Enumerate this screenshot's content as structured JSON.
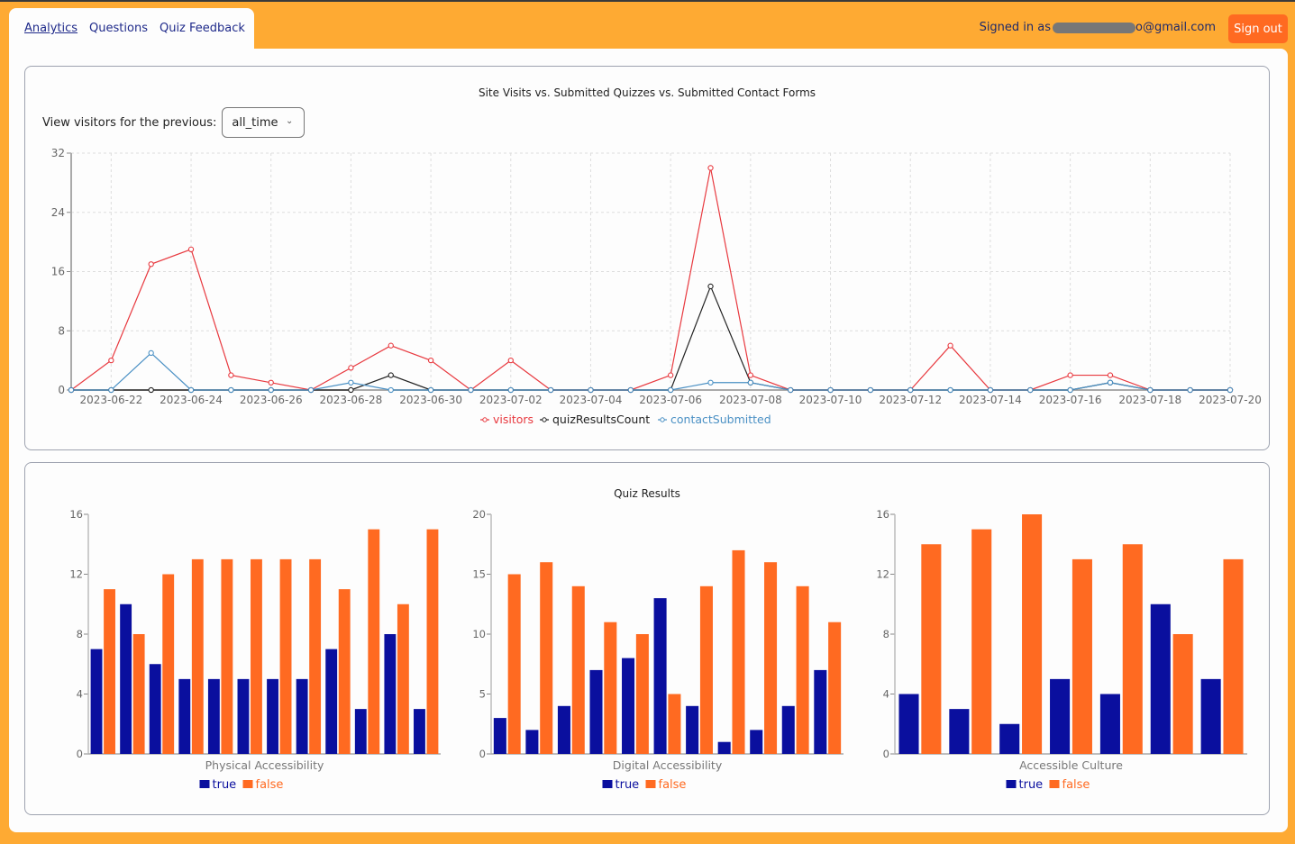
{
  "nav": {
    "items": [
      {
        "label": "Analytics",
        "active": true
      },
      {
        "label": "Questions",
        "active": false
      },
      {
        "label": "Quiz Feedback",
        "active": false
      }
    ]
  },
  "user": {
    "signed_in_prefix": "Signed in as",
    "email_suffix": "o@gmail.com",
    "sign_out_label": "Sign out"
  },
  "colors": {
    "accent": "#feaa33",
    "button": "#ff6a21",
    "true_bar": "#0a0f9e",
    "false_bar": "#ff6a21",
    "visitors": "#e8393f",
    "quiz": "#222222",
    "contact": "#4a90c4"
  },
  "filter": {
    "label": "View visitors for the previous:",
    "value": "all_time"
  },
  "chart_data": [
    {
      "type": "line",
      "title": "Site Visits vs. Submitted Quizzes vs. Submitted Contact Forms",
      "x": [
        "2023-06-21",
        "2023-06-22",
        "2023-06-23",
        "2023-06-24",
        "2023-06-25",
        "2023-06-26",
        "2023-06-27",
        "2023-06-28",
        "2023-06-29",
        "2023-06-30",
        "2023-07-01",
        "2023-07-02",
        "2023-07-03",
        "2023-07-04",
        "2023-07-05",
        "2023-07-06",
        "2023-07-07",
        "2023-07-08",
        "2023-07-09",
        "2023-07-10",
        "2023-07-11",
        "2023-07-12",
        "2023-07-13",
        "2023-07-14",
        "2023-07-15",
        "2023-07-16",
        "2023-07-17",
        "2023-07-18",
        "2023-07-19",
        "2023-07-20"
      ],
      "x_tick_labels": [
        "2023-06-22",
        "2023-06-24",
        "2023-06-26",
        "2023-06-28",
        "2023-06-30",
        "2023-07-02",
        "2023-07-04",
        "2023-07-06",
        "2023-07-08",
        "2023-07-10",
        "2023-07-12",
        "2023-07-14",
        "2023-07-16",
        "2023-07-18",
        "2023-07-20"
      ],
      "y_ticks": [
        0,
        8,
        16,
        24,
        32
      ],
      "ylim": [
        0,
        32
      ],
      "grid": true,
      "legend_position": "bottom",
      "series": [
        {
          "name": "visitors",
          "color": "#e8393f",
          "values": [
            0,
            4,
            17,
            19,
            2,
            1,
            0,
            3,
            6,
            4,
            0,
            4,
            0,
            0,
            0,
            2,
            30,
            2,
            0,
            0,
            0,
            0,
            6,
            0,
            0,
            2,
            2,
            0,
            0,
            0
          ]
        },
        {
          "name": "quizResultsCount",
          "color": "#222222",
          "values": [
            0,
            0,
            0,
            0,
            0,
            0,
            0,
            0,
            2,
            0,
            0,
            0,
            0,
            0,
            0,
            0,
            14,
            1,
            0,
            0,
            0,
            0,
            0,
            0,
            0,
            0,
            1,
            0,
            0,
            0
          ]
        },
        {
          "name": "contactSubmitted",
          "color": "#4a90c4",
          "values": [
            0,
            0,
            5,
            0,
            0,
            0,
            0,
            1,
            0,
            0,
            0,
            0,
            0,
            0,
            0,
            0,
            1,
            1,
            0,
            0,
            0,
            0,
            0,
            0,
            0,
            0,
            1,
            0,
            0,
            0
          ]
        }
      ]
    },
    {
      "type": "bar",
      "title": "Quiz Results",
      "xlabel": "Physical Accessibility",
      "ylim": [
        0,
        16
      ],
      "y_ticks": [
        0,
        4,
        8,
        12,
        16
      ],
      "legend": [
        "true",
        "false"
      ],
      "series": [
        {
          "name": "true",
          "values": [
            7,
            10,
            6,
            5,
            5,
            5,
            5,
            5,
            7,
            3,
            8,
            3
          ]
        },
        {
          "name": "false",
          "values": [
            11,
            8,
            12,
            13,
            13,
            13,
            13,
            13,
            11,
            15,
            10,
            15
          ]
        }
      ]
    },
    {
      "type": "bar",
      "xlabel": "Digital Accessibility",
      "ylim": [
        0,
        20
      ],
      "y_ticks": [
        0,
        5,
        10,
        15,
        20
      ],
      "legend": [
        "true",
        "false"
      ],
      "series": [
        {
          "name": "true",
          "values": [
            3,
            2,
            4,
            7,
            8,
            13,
            4,
            1,
            2,
            4,
            7
          ]
        },
        {
          "name": "false",
          "values": [
            15,
            16,
            14,
            11,
            10,
            5,
            14,
            17,
            16,
            14,
            11
          ]
        }
      ]
    },
    {
      "type": "bar",
      "xlabel": "Accessible Culture",
      "ylim": [
        0,
        16
      ],
      "y_ticks": [
        0,
        4,
        8,
        12,
        16
      ],
      "legend": [
        "true",
        "false"
      ],
      "series": [
        {
          "name": "true",
          "values": [
            4,
            3,
            2,
            5,
            4,
            10,
            5
          ]
        },
        {
          "name": "false",
          "values": [
            14,
            15,
            16,
            13,
            14,
            8,
            13
          ]
        }
      ]
    }
  ]
}
